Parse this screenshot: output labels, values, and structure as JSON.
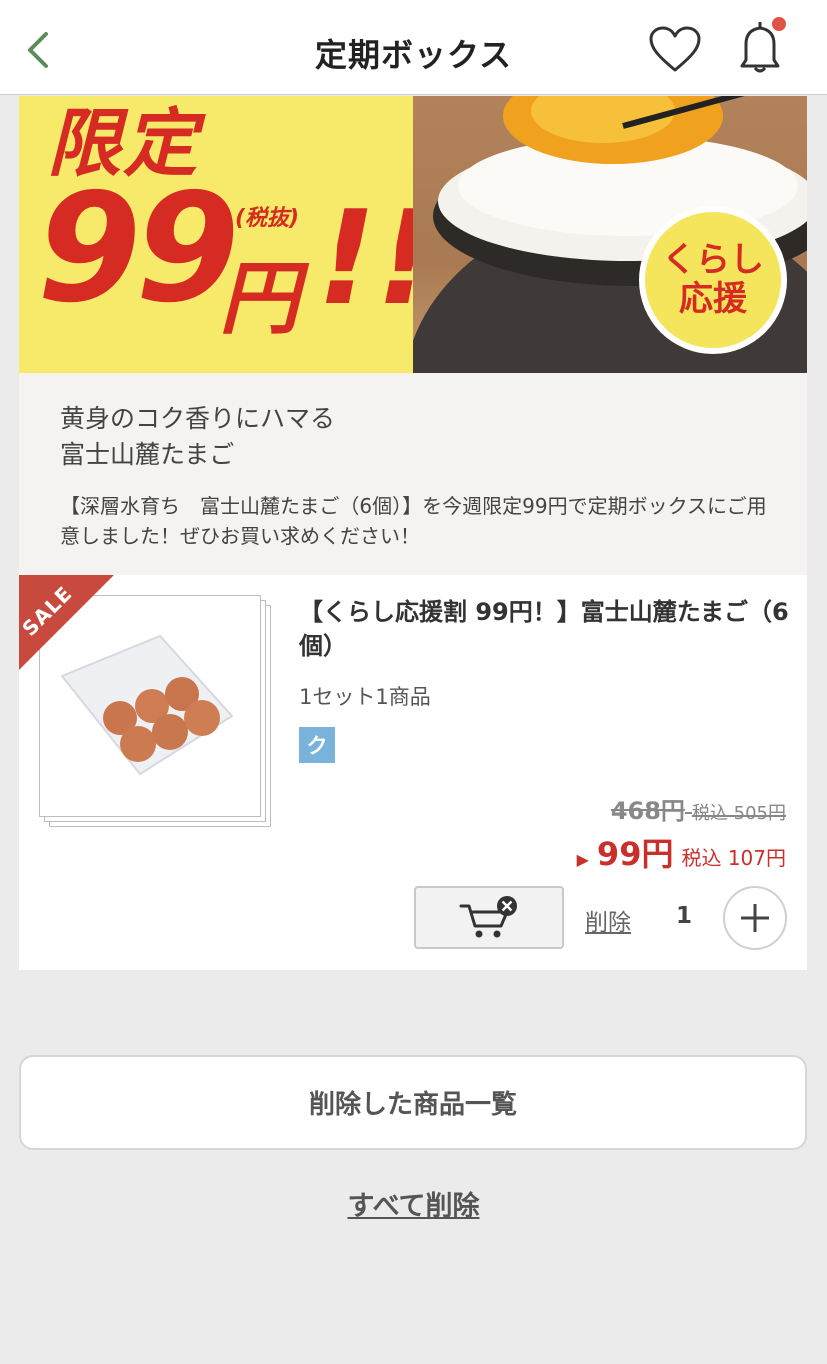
{
  "header": {
    "title": "定期ボックス",
    "back_icon": "chevron-left-icon",
    "favorite_icon": "heart-icon",
    "notification_icon": "bell-icon",
    "notification_dot_color": "#e05445",
    "back_color": "#5d8c5a"
  },
  "banner": {
    "limited": "限定",
    "price": "99",
    "yen": "円",
    "tax": "(税抜)",
    "exclaim": "!!",
    "badge_line1": "くらし",
    "badge_line2": "応援",
    "accent_color": "#d62b23",
    "bg_color": "#f7e96a"
  },
  "description": {
    "title_line1": "黄身のコク香りにハマる",
    "title_line2": "富士山麓たまご",
    "body": "【深層水育ち　富士山麓たまご（6個）】を今週限定99円で定期ボックスにご用意しました！ぜひお買い求めください！"
  },
  "product": {
    "sale_label": "SALE",
    "name": "【くらし応援割 99円！】富士山麓たまご（6個）",
    "set_info": "1セット1商品",
    "tag": "ク",
    "old_price": "468円",
    "old_price_tax": "税込 505円",
    "new_price": "99円",
    "new_price_tax": "税込 107円",
    "price_arrow": "▶",
    "delete_label": "削除",
    "quantity": "1",
    "cart_icon": "cart-remove-icon",
    "plus_icon": "plus-icon"
  },
  "footer": {
    "deleted_list_label": "削除した商品一覧",
    "delete_all_label": "すべて削除"
  }
}
